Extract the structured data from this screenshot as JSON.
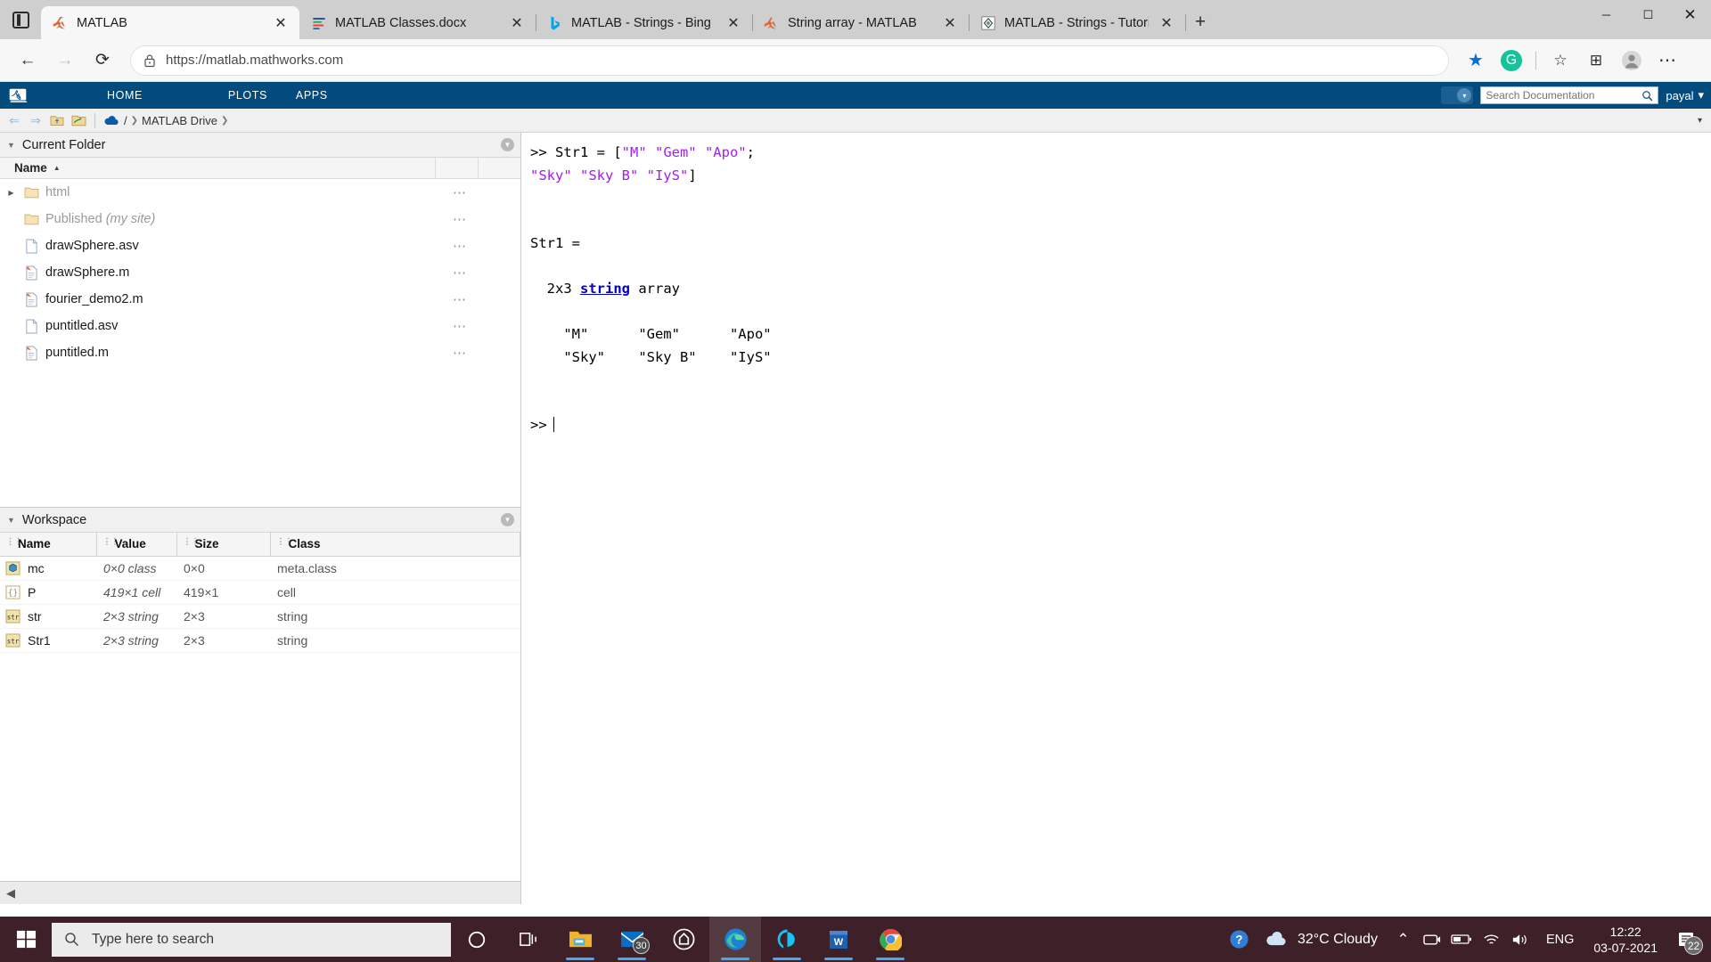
{
  "browser": {
    "tabs": [
      {
        "label": "MATLAB",
        "icon": "matlab-icon",
        "active": true
      },
      {
        "label": "MATLAB Classes.docx",
        "icon": "word-doc-icon",
        "active": false
      },
      {
        "label": "MATLAB - Strings - Bing",
        "icon": "bing-icon",
        "active": false
      },
      {
        "label": "String array - MATLAB",
        "icon": "matlab-icon",
        "active": false
      },
      {
        "label": "MATLAB - Strings - Tutorialspoin",
        "icon": "tutorialspoint-icon",
        "active": false
      }
    ],
    "new_tab_label": "+",
    "close_label": "✕",
    "window_controls": {
      "minimize": "─",
      "maximize": "☐",
      "close": "✕"
    },
    "toolbar": {
      "back": "←",
      "forward": "→",
      "reload": "⟳",
      "lock_icon": "lock-icon",
      "url": "https://matlab.mathworks.com",
      "favorite_star": "★",
      "grammarly": "G",
      "collections": "☆",
      "split_screen": "⊞",
      "profile": "●",
      "more": "⋯"
    }
  },
  "matlab": {
    "ribbon": {
      "tabs": [
        "HOME",
        "PLOTS",
        "APPS"
      ],
      "search_placeholder": "Search Documentation",
      "user": "payal",
      "user_caret": "▾"
    },
    "breadcrumb": {
      "back": "⇐",
      "forward": "⇒",
      "up_folder": "up-folder-icon",
      "browse_folder": "browse-folder-icon",
      "root": "/",
      "path": "MATLAB Drive",
      "arrow": "❯",
      "caret": "▾"
    },
    "current_folder": {
      "title": "Current Folder",
      "column_name": "Name",
      "sort_caret": "▲",
      "files": [
        {
          "name": "html",
          "type": "folder",
          "dim": true,
          "expandable": true,
          "italic_suffix": ""
        },
        {
          "name": "Published ",
          "type": "folder",
          "dim": true,
          "expandable": false,
          "italic_suffix": "(my site)"
        },
        {
          "name": "drawSphere.asv",
          "type": "file-plain",
          "dim": false,
          "expandable": false,
          "italic_suffix": ""
        },
        {
          "name": "drawSphere.m",
          "type": "file-m",
          "dim": false,
          "expandable": false,
          "italic_suffix": ""
        },
        {
          "name": "fourier_demo2.m",
          "type": "file-m",
          "dim": false,
          "expandable": false,
          "italic_suffix": ""
        },
        {
          "name": "puntitled.asv",
          "type": "file-plain",
          "dim": false,
          "expandable": false,
          "italic_suffix": ""
        },
        {
          "name": "puntitled.m",
          "type": "file-m",
          "dim": false,
          "expandable": false,
          "italic_suffix": ""
        }
      ],
      "row_menu": "⋯"
    },
    "workspace": {
      "title": "Workspace",
      "columns": [
        "Name",
        "Value",
        "Size",
        "Class"
      ],
      "rows": [
        {
          "name": "mc",
          "value": "0×0 class",
          "size": "0×0",
          "class": "meta.class",
          "icon": "class-icon"
        },
        {
          "name": "P",
          "value": "419×1 cell",
          "size": "419×1",
          "class": "cell",
          "icon": "cell-icon"
        },
        {
          "name": "str",
          "value": "2×3 string",
          "size": "2×3",
          "class": "string",
          "icon": "string-icon"
        },
        {
          "name": "Str1",
          "value": "2×3 string",
          "size": "2×3",
          "class": "string",
          "icon": "string-icon"
        }
      ]
    },
    "command_window": {
      "lines": [
        {
          "segments": [
            {
              "t": ">> Str1 = [",
              "c": "plain"
            },
            {
              "t": "\"M\" \"Gem\" \"Apo\"",
              "c": "string"
            },
            {
              "t": ";",
              "c": "plain"
            }
          ]
        },
        {
          "segments": [
            {
              "t": "\"Sky\" \"Sky B\" \"IyS\"",
              "c": "string"
            },
            {
              "t": "]",
              "c": "plain"
            }
          ]
        },
        {
          "segments": []
        },
        {
          "segments": []
        },
        {
          "segments": [
            {
              "t": "Str1 =",
              "c": "plain"
            }
          ]
        },
        {
          "segments": []
        },
        {
          "segments": [
            {
              "t": "  2x3 ",
              "c": "plain"
            },
            {
              "t": "string",
              "c": "link"
            },
            {
              "t": " array",
              "c": "plain"
            }
          ]
        },
        {
          "segments": []
        },
        {
          "segments": [
            {
              "t": "    \"M\"      \"Gem\"      \"Apo\"",
              "c": "plain"
            }
          ]
        },
        {
          "segments": [
            {
              "t": "    \"Sky\"    \"Sky B\"    \"IyS\"",
              "c": "plain"
            }
          ]
        },
        {
          "segments": []
        },
        {
          "segments": []
        },
        {
          "segments": [
            {
              "t": ">>",
              "c": "plain"
            },
            {
              "t": "",
              "c": "caret"
            }
          ]
        }
      ]
    },
    "footer_collapse": "◀"
  },
  "taskbar": {
    "start_icon": "windows-logo-icon",
    "search_placeholder": "Type here to search",
    "search_icon": "search-icon",
    "apps": [
      {
        "name": "cortana-icon",
        "running": false,
        "focused": false,
        "badge": ""
      },
      {
        "name": "task-view-icon",
        "running": false,
        "focused": false,
        "badge": ""
      },
      {
        "name": "file-explorer-icon",
        "running": true,
        "focused": false,
        "badge": ""
      },
      {
        "name": "mail-icon",
        "running": true,
        "focused": false,
        "badge": "30"
      },
      {
        "name": "amazon-icon",
        "running": false,
        "focused": false,
        "badge": ""
      },
      {
        "name": "edge-icon",
        "running": true,
        "focused": true,
        "badge": ""
      },
      {
        "name": "alexa-icon",
        "running": true,
        "focused": false,
        "badge": ""
      },
      {
        "name": "word-icon",
        "running": true,
        "focused": false,
        "badge": ""
      },
      {
        "name": "chrome-icon",
        "running": true,
        "focused": false,
        "badge": ""
      }
    ],
    "tray": {
      "help_icon": "help-icon",
      "weather_icon": "cloud-icon",
      "weather_text": "32°C  Cloudy",
      "chevron_up": "⌃",
      "onedrive_icon": "onedrive-icon",
      "battery_icon": "battery-icon",
      "wifi_icon": "wifi-icon",
      "volume_icon": "volume-icon",
      "language": "ENG",
      "time": "12:22",
      "date": "03-07-2021",
      "notification_count": "22"
    }
  },
  "colors": {
    "matlab_blue": "#034a7d",
    "accent_blue": "#0078d4",
    "string_purple": "#a020f0",
    "link_blue": "#0000c8",
    "taskbar_bg": "#3d2028"
  }
}
